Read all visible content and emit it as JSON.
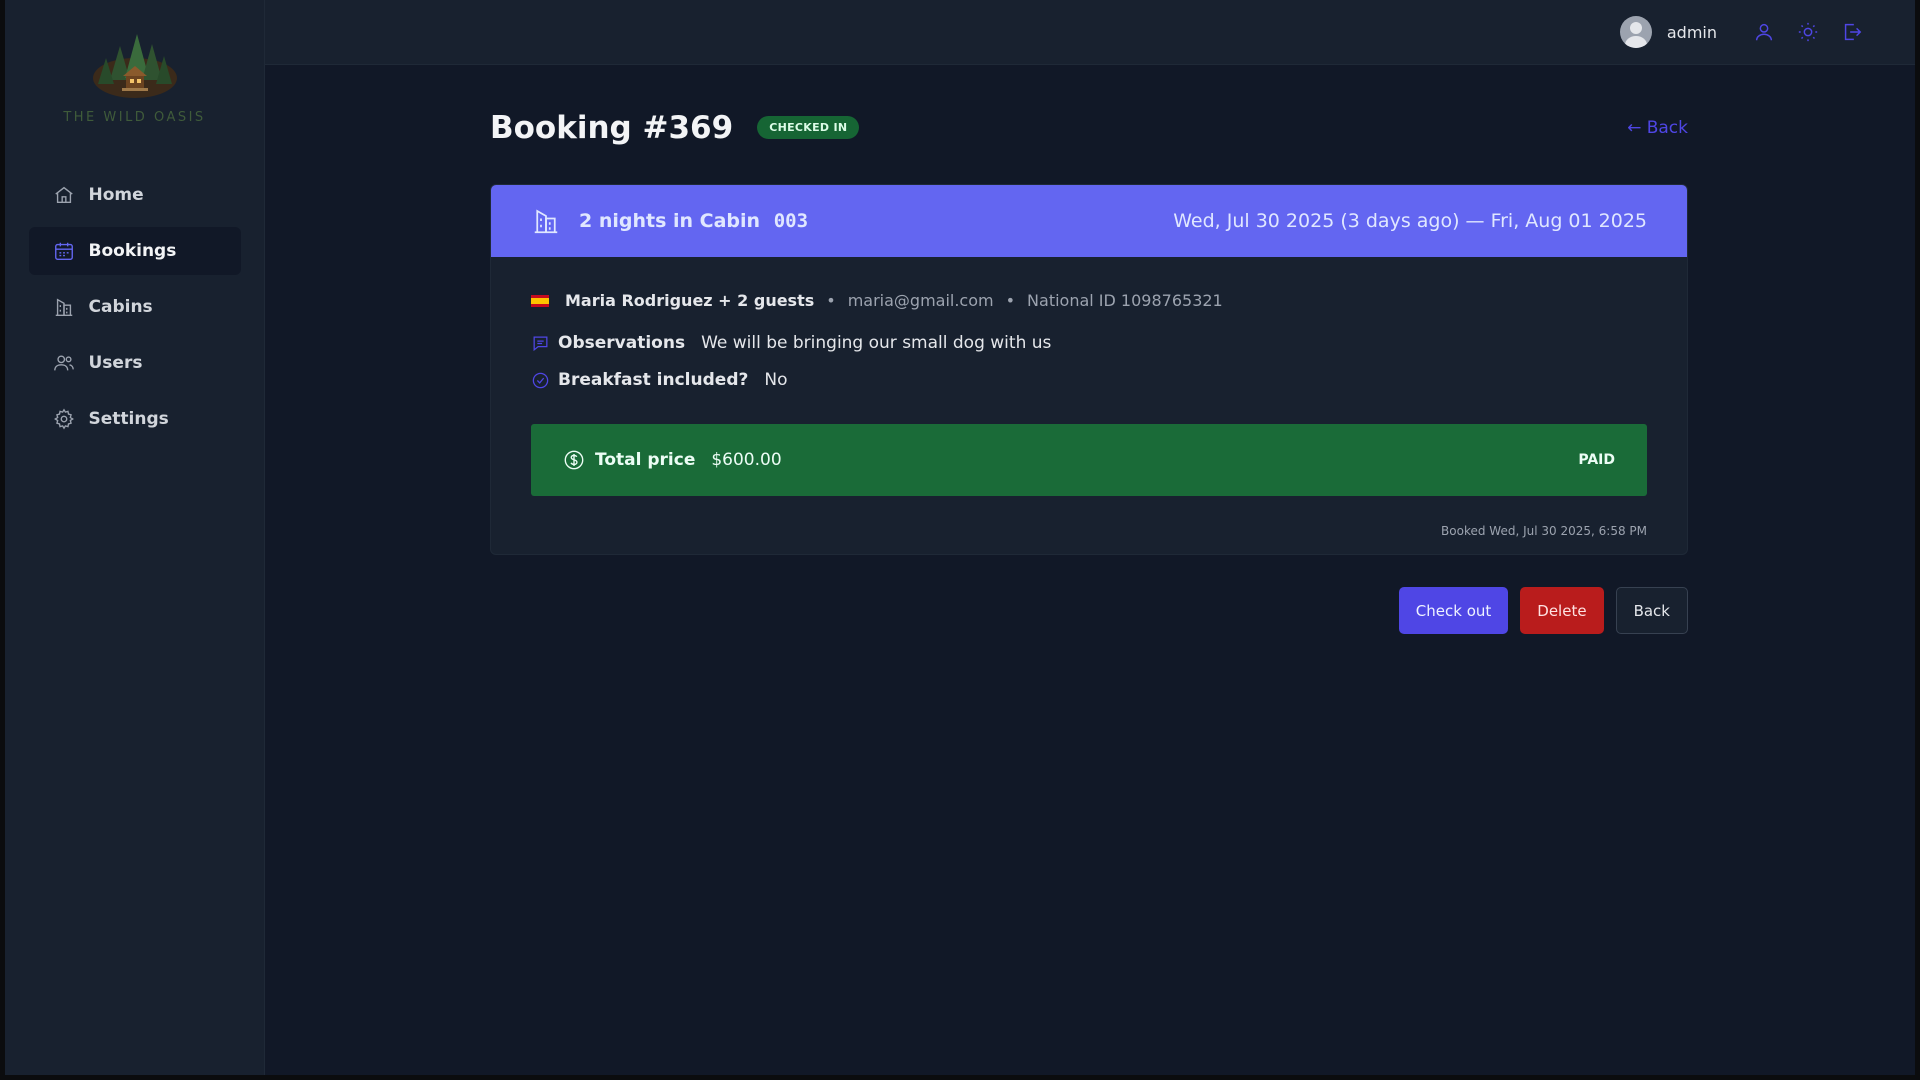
{
  "app": {
    "logo_text": "THE WILD OASIS"
  },
  "sidebar": {
    "items": [
      {
        "label": "Home",
        "icon": "home-icon"
      },
      {
        "label": "Bookings",
        "icon": "calendar-icon",
        "active": true
      },
      {
        "label": "Cabins",
        "icon": "cabin-icon"
      },
      {
        "label": "Users",
        "icon": "users-icon"
      },
      {
        "label": "Settings",
        "icon": "gear-icon"
      }
    ]
  },
  "header": {
    "username": "admin",
    "icons": [
      "user-icon",
      "sun-icon",
      "logout-icon"
    ]
  },
  "page": {
    "title": "Booking #369",
    "status": "CHECKED IN",
    "back_link": "← Back"
  },
  "booking": {
    "nights_text": "2 nights in Cabin",
    "cabin_number": "003",
    "dates": "Wed, Jul 30 2025 (3 days ago) — Fri, Aug 01 2025",
    "guest_name": "Maria Rodriguez + 2 guests",
    "separator": "•",
    "email": "maria@gmail.com",
    "national_id": "National ID 1098765321",
    "observations_label": "Observations",
    "observations_value": "We will be bringing our small dog with us",
    "breakfast_label": "Breakfast included?",
    "breakfast_value": "No",
    "price_label": "Total price",
    "price_value": "$600.00",
    "paid_status": "PAID",
    "booked_at": "Booked Wed, Jul 30 2025, 6:58 PM"
  },
  "actions": {
    "checkout": "Check out",
    "delete": "Delete",
    "back": "Back"
  },
  "colors": {
    "accent": "#4f46e5",
    "header_band": "#6366f1",
    "paid_green": "#1a6b38",
    "danger": "#b91c1c",
    "badge_green": "#166534"
  }
}
